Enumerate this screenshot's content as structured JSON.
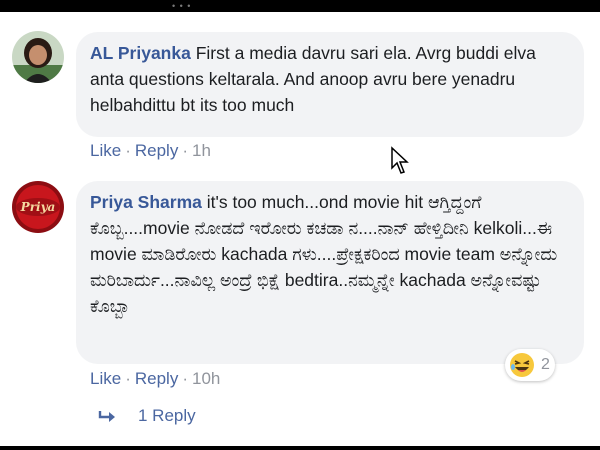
{
  "top_bar": {
    "dots": "• • •"
  },
  "comments": [
    {
      "author": "AL Priyanka",
      "text": "First a media davru sari ela. Avrg buddi elva anta questions keltarala. And anoop avru bere yenadru helbahdittu bt its too much",
      "like_label": "Like",
      "reply_label": "Reply",
      "time": "1h",
      "separator": "·"
    },
    {
      "author": "Priya Sharma",
      "text": "it's too much...ond movie hit ಆಗ್ತಿದ್ದಂಗೆ ಕೊಬ್ಬ....movie ನೋಡದೆ ಇರೋರು ಕಚಡಾ ನ....ನಾನ್ ಹೇಳ್ತಿದೀನಿ kelkoli...ಈ movie ಮಾಡಿರೋರು kachada ಗಳು....ಪ್ರೇಕ್ಷಕರಿಂದ movie team ಅನ್ನೋದು ಮರಿಬಾರ್ದು...ನಾವಿಲ್ಲ ಅಂದ್ರೆ ಭಿಕ್ಷೆ bedtira..ನಮ್ಮನ್ನೇ kachada ಅನ್ನೋವಷ್ಟು ಕೊಬ್ಬಾ",
      "like_label": "Like",
      "reply_label": "Reply",
      "time": "10h",
      "separator": "·",
      "reaction": {
        "icon": "laughing-emoji-icon",
        "count": "2"
      },
      "avatar_text": "Priya"
    }
  ],
  "replies_link": {
    "label": "1 Reply",
    "icon": "reply-arrow-icon"
  },
  "colors": {
    "link": "#4b67a1",
    "author": "#385898",
    "bubble": "#f2f3f5",
    "meta": "#90949c"
  }
}
